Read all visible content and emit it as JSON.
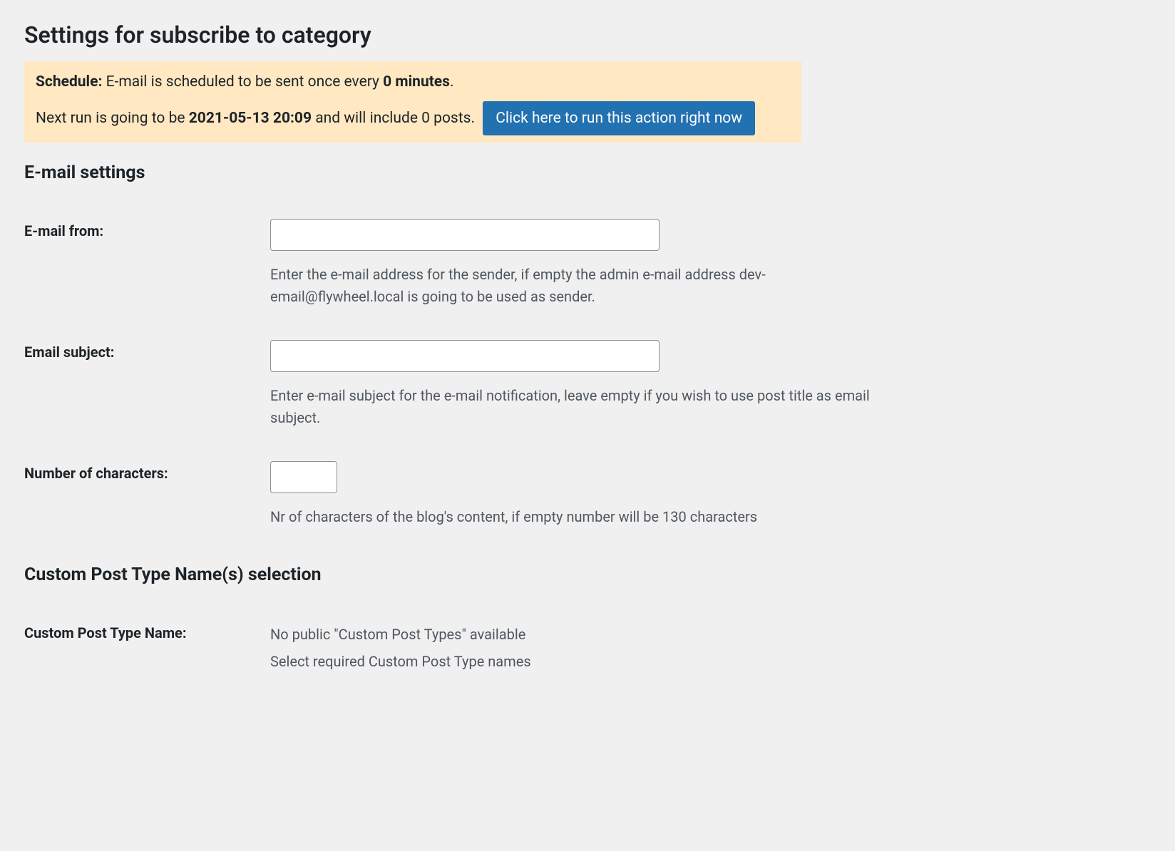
{
  "page": {
    "title": "Settings for subscribe to category"
  },
  "notice": {
    "label": "Schedule:",
    "line1_pre": " E-mail is scheduled to be sent once every ",
    "interval": "0 minutes",
    "line1_post": ".",
    "line2_pre": "Next run is going to be ",
    "next_run": "2021-05-13 20:09",
    "line2_post": " and will include 0 posts. ",
    "button": "Click here to run this action right now"
  },
  "sections": {
    "email": {
      "heading": "E-mail settings",
      "fields": {
        "from": {
          "label": "E-mail from:",
          "value": "",
          "help": "Enter the e-mail address for the sender, if empty the admin e-mail address dev-email@flywheel.local is going to be used as sender."
        },
        "subject": {
          "label": "Email subject:",
          "value": "",
          "help": "Enter e-mail subject for the e-mail notification, leave empty if you wish to use post title as email subject."
        },
        "chars": {
          "label": "Number of characters:",
          "value": "",
          "help": "Nr of characters of the blog's content, if empty number will be 130 characters"
        }
      }
    },
    "cpt": {
      "heading": "Custom Post Type Name(s) selection",
      "field": {
        "label": "Custom Post Type Name:",
        "value": "No public \"Custom Post Types\" available",
        "help": "Select required Custom Post Type names"
      }
    }
  }
}
